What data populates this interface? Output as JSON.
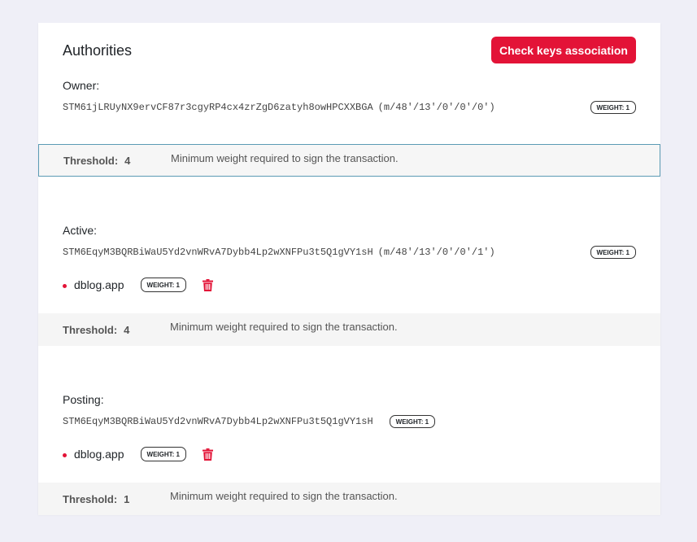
{
  "header": {
    "title": "Authorities",
    "check_button_label": "Check keys association"
  },
  "sections": {
    "owner": {
      "label": "Owner:",
      "key": "STM61jLRUyNX9ervCF87r3cgyRP4cx4zrZgD6zatyh8owHPCXXBGA",
      "path": "(m/48′/13′/0′/0′/0′)",
      "key_weight": "WEIGHT: 1",
      "threshold_label": "Threshold:",
      "threshold_value": "4",
      "threshold_desc": "Minimum weight required to sign the transaction."
    },
    "active": {
      "label": "Active:",
      "key": "STM6EqyM3BQRBiWaU5Yd2vnWRvA7Dybb4Lp2wXNFPu3t5Q1gVY1sH",
      "path": "(m/48′/13′/0′/0′/1′)",
      "key_weight": "WEIGHT: 1",
      "account": "dblog.app",
      "account_weight": "WEIGHT: 1",
      "threshold_label": "Threshold:",
      "threshold_value": "4",
      "threshold_desc": "Minimum weight required to sign the transaction."
    },
    "posting": {
      "label": "Posting:",
      "key": "STM6EqyM3BQRBiWaU5Yd2vnWRvA7Dybb4Lp2wXNFPu3t5Q1gVY1sH",
      "key_weight": "WEIGHT: 1",
      "account": "dblog.app",
      "account_weight": "WEIGHT: 1",
      "threshold_label": "Threshold:",
      "threshold_value": "1",
      "threshold_desc": "Minimum weight required to sign the transaction."
    }
  },
  "icons": {
    "delete": "trash-icon",
    "bullet": "bullet-dot"
  },
  "colors": {
    "accent": "#e31337",
    "background": "#efeff7",
    "threshold_bg": "#f5f5f5",
    "focus_border": "#5b9bb5"
  }
}
